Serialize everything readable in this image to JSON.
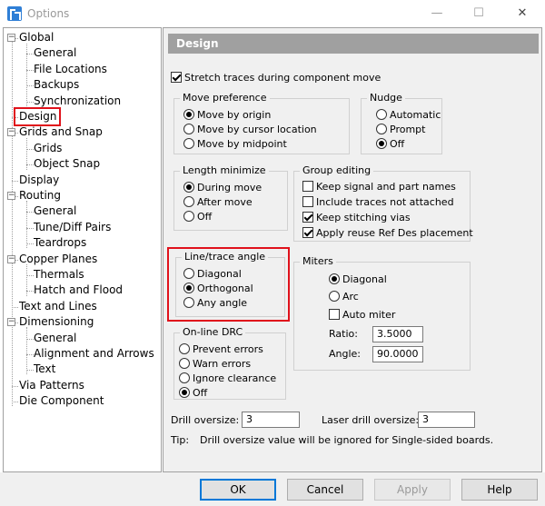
{
  "window": {
    "title": "Options",
    "minimize_glyph": "—",
    "maximize_glyph": "☐",
    "close_glyph": "✕",
    "app_icon": "app-logo-icon"
  },
  "tree": {
    "items": [
      {
        "label": "Global",
        "level": 0,
        "expander": "−"
      },
      {
        "label": "General",
        "level": 1
      },
      {
        "label": "File Locations",
        "level": 1
      },
      {
        "label": "Backups",
        "level": 1
      },
      {
        "label": "Synchronization",
        "level": 1
      },
      {
        "label": "Design",
        "level": 0,
        "selected": true
      },
      {
        "label": "Grids and Snap",
        "level": 0,
        "expander": "−"
      },
      {
        "label": "Grids",
        "level": 1
      },
      {
        "label": "Object Snap",
        "level": 1
      },
      {
        "label": "Display",
        "level": 0
      },
      {
        "label": "Routing",
        "level": 0,
        "expander": "−"
      },
      {
        "label": "General",
        "level": 1
      },
      {
        "label": "Tune/Diff Pairs",
        "level": 1
      },
      {
        "label": "Teardrops",
        "level": 1
      },
      {
        "label": "Copper Planes",
        "level": 0,
        "expander": "−"
      },
      {
        "label": "Thermals",
        "level": 1
      },
      {
        "label": "Hatch and Flood",
        "level": 1
      },
      {
        "label": "Text and Lines",
        "level": 0
      },
      {
        "label": "Dimensioning",
        "level": 0,
        "expander": "−"
      },
      {
        "label": "General",
        "level": 1
      },
      {
        "label": "Alignment and Arrows",
        "level": 1
      },
      {
        "label": "Text",
        "level": 1
      },
      {
        "label": "Via Patterns",
        "level": 0
      },
      {
        "label": "Die Component",
        "level": 0
      }
    ]
  },
  "design": {
    "header": "Design",
    "stretch_traces": {
      "label": "Stretch traces during component move",
      "checked": true
    },
    "move_preference": {
      "title": "Move preference",
      "options": [
        {
          "label": "Move by origin",
          "selected": true
        },
        {
          "label": "Move by cursor location",
          "selected": false
        },
        {
          "label": "Move by midpoint",
          "selected": false
        }
      ]
    },
    "nudge": {
      "title": "Nudge",
      "options": [
        {
          "label": "Automatic",
          "selected": false
        },
        {
          "label": "Prompt",
          "selected": false
        },
        {
          "label": "Off",
          "selected": true
        }
      ]
    },
    "length_minimize": {
      "title": "Length minimize",
      "options": [
        {
          "label": "During move",
          "selected": true
        },
        {
          "label": "After move",
          "selected": false
        },
        {
          "label": "Off",
          "selected": false
        }
      ]
    },
    "group_editing": {
      "title": "Group editing",
      "options": [
        {
          "label": "Keep signal and part names",
          "checked": false
        },
        {
          "label": "Include traces not attached",
          "checked": false
        },
        {
          "label": "Keep stitching vias",
          "checked": true
        },
        {
          "label": "Apply reuse Ref Des placement",
          "checked": true
        }
      ]
    },
    "line_trace_angle": {
      "title": "Line/trace angle",
      "options": [
        {
          "label": "Diagonal",
          "selected": false
        },
        {
          "label": "Orthogonal",
          "selected": true
        },
        {
          "label": "Any angle",
          "selected": false
        }
      ]
    },
    "miters": {
      "title": "Miters",
      "options": [
        {
          "label": "Diagonal",
          "selected": true
        },
        {
          "label": "Arc",
          "selected": false
        }
      ],
      "auto_miter": {
        "label": "Auto miter",
        "checked": false
      },
      "ratio_label": "Ratio:",
      "ratio_value": "3.5000",
      "angle_label": "Angle:",
      "angle_value": "90.0000"
    },
    "online_drc": {
      "title": "On-line DRC",
      "options": [
        {
          "label": "Prevent errors",
          "selected": false
        },
        {
          "label": "Warn errors",
          "selected": false
        },
        {
          "label": "Ignore clearance",
          "selected": false
        },
        {
          "label": "Off",
          "selected": true
        }
      ]
    },
    "drill_oversize": {
      "label": "Drill oversize:",
      "value": "3"
    },
    "laser_drill_oversize": {
      "label": "Laser drill oversize:",
      "value": "3"
    },
    "tip": {
      "label": "Tip:",
      "text": "Drill oversize value will be ignored for Single-sided boards."
    }
  },
  "buttons": {
    "ok": "OK",
    "cancel": "Cancel",
    "apply": "Apply",
    "help": "Help"
  },
  "colors": {
    "highlight": "#e0111b",
    "header_bg": "#a0a0a0",
    "default_button_border": "#0078d7"
  }
}
